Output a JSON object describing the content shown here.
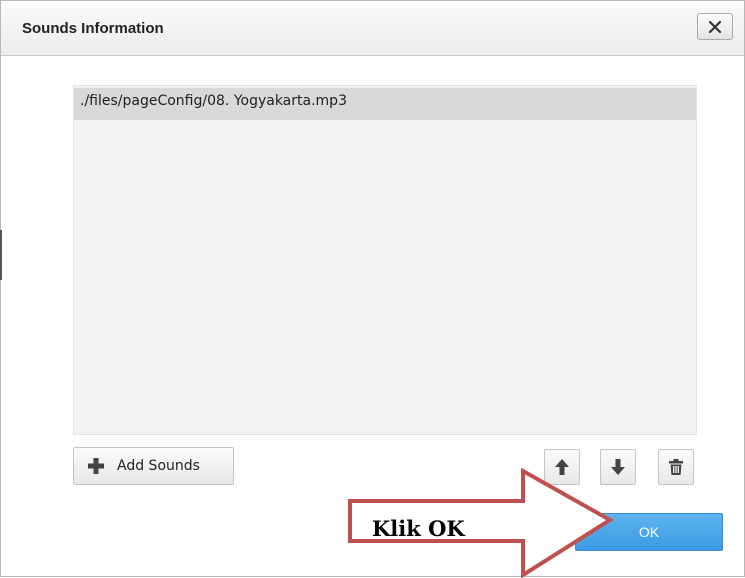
{
  "dialog": {
    "title": "Sounds Information",
    "close_icon": "close-icon"
  },
  "sounds_list": {
    "items": [
      "./files/pageConfig/08. Yogyakarta.mp3"
    ],
    "selected_index": 0
  },
  "toolbar": {
    "add_label": "Add Sounds",
    "add_icon": "plus-icon",
    "move_up_icon": "arrow-up-icon",
    "move_down_icon": "arrow-down-icon",
    "delete_icon": "trash-icon"
  },
  "footer": {
    "ok_label": "OK"
  },
  "annotation": {
    "text": "Klik OK",
    "arrow_color": "#c0504d"
  },
  "colors": {
    "ok_button": "#4aa6e8",
    "list_background": "#f2f2f2",
    "selected_row": "#d9d9d9"
  }
}
